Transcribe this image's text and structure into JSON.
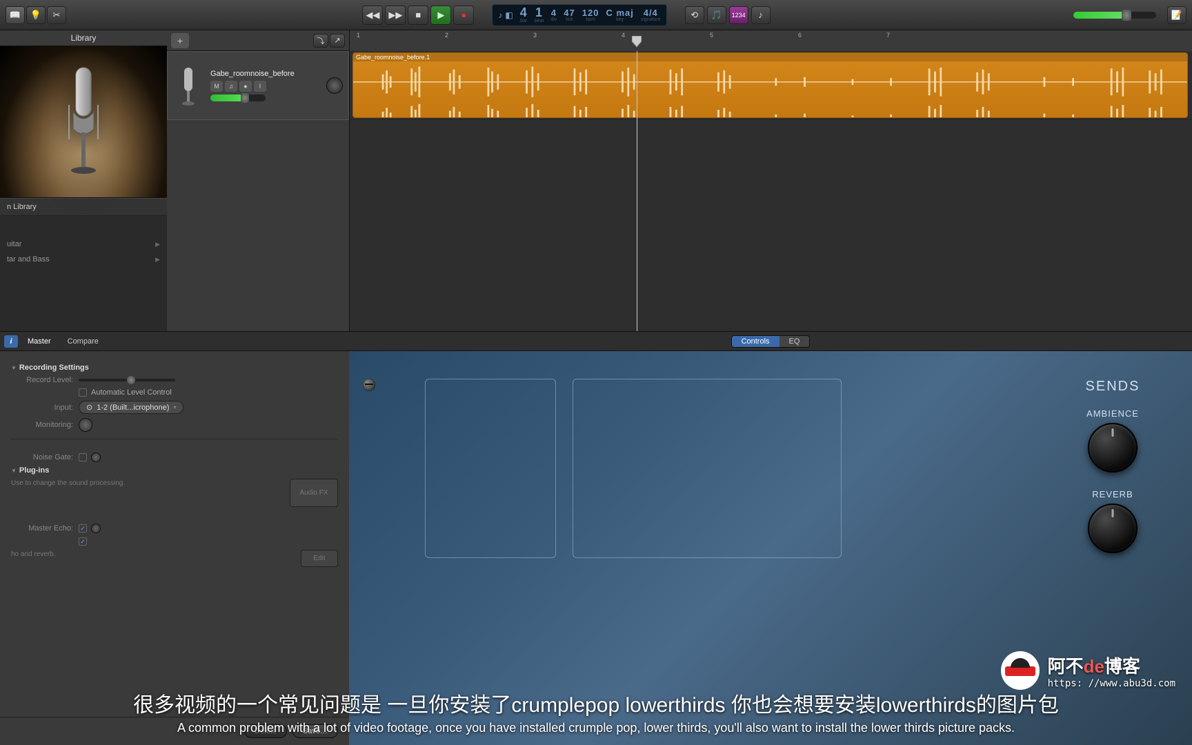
{
  "toolbar": {
    "icons": {
      "lib": "📖",
      "metronome": "💡",
      "countin": "✂"
    },
    "right_icons": {
      "cycle": "⟲",
      "tuner": "🎵",
      "tempo": "1234",
      "notepad": "♪"
    }
  },
  "transport": {
    "rewind": "◀◀",
    "forward": "▶▶",
    "stop": "■",
    "play": "▶",
    "record": "●"
  },
  "lcd": {
    "note_icon": "♪",
    "beat_icon": "◧",
    "bar": "4",
    "bar_lbl": "bar",
    "beat": "1",
    "beat_lbl": "beat",
    "div": "4",
    "div_lbl": "div",
    "tick": "47",
    "tick_lbl": "tick",
    "tempo": "120",
    "tempo_lbl": "bpm",
    "key": "C maj",
    "key_lbl": "key",
    "sig": "4/4",
    "sig_lbl": "signature"
  },
  "library": {
    "title": "Library",
    "browser_row": "n Library",
    "items": [
      {
        "label": "uitar"
      },
      {
        "label": "tar and Bass"
      }
    ]
  },
  "track_header": {
    "add": "+"
  },
  "ruler": {
    "markers": [
      "1",
      "2",
      "3",
      "4",
      "5",
      "6",
      "7"
    ]
  },
  "track": {
    "name": "Gabe_roomnoise_before",
    "mute": "M",
    "solo": "♫",
    "rec": "●",
    "input": "I"
  },
  "region": {
    "name": "Gabe_roomnoise_before.1"
  },
  "inspector": {
    "info": "i",
    "master": "Master",
    "compare": "Compare",
    "controls": "Controls",
    "eq": "EQ",
    "recording_settings": "Recording Settings",
    "record_level": "Record Level:",
    "auto_level": "Automatic Level Control",
    "input": "Input:",
    "input_val": "1-2 (Built...icrophone)",
    "input_icon": "⊙",
    "monitoring": "Monitoring:",
    "noise_gate": "Noise Gate:",
    "plugins": "Plug-ins",
    "plugin_desc": "Use to change the sound processing.",
    "audio_fx": "Audio FX",
    "master_echo": "Master Echo:",
    "master_reverb_desc": "ho and reverb.",
    "edit_btn": "Edit",
    "delete": "Delete",
    "save": "Save…"
  },
  "smart": {
    "sends": "SENDS",
    "ambience": "AMBIENCE",
    "reverb": "REVERB"
  },
  "subtitles": {
    "cn": "很多视频的一个常见问题是 一旦你安装了crumplepop lowerthirds 你也会想要安装lowerthirds的图片包",
    "en": "A common problem with a lot of video footage, once you have installed crumple pop, lower thirds, you'll also want to install the lower thirds picture packs."
  },
  "watermark": {
    "title_a": "阿不",
    "title_de": "de",
    "title_b": "博客",
    "url": "https: //www.abu3d.com"
  }
}
